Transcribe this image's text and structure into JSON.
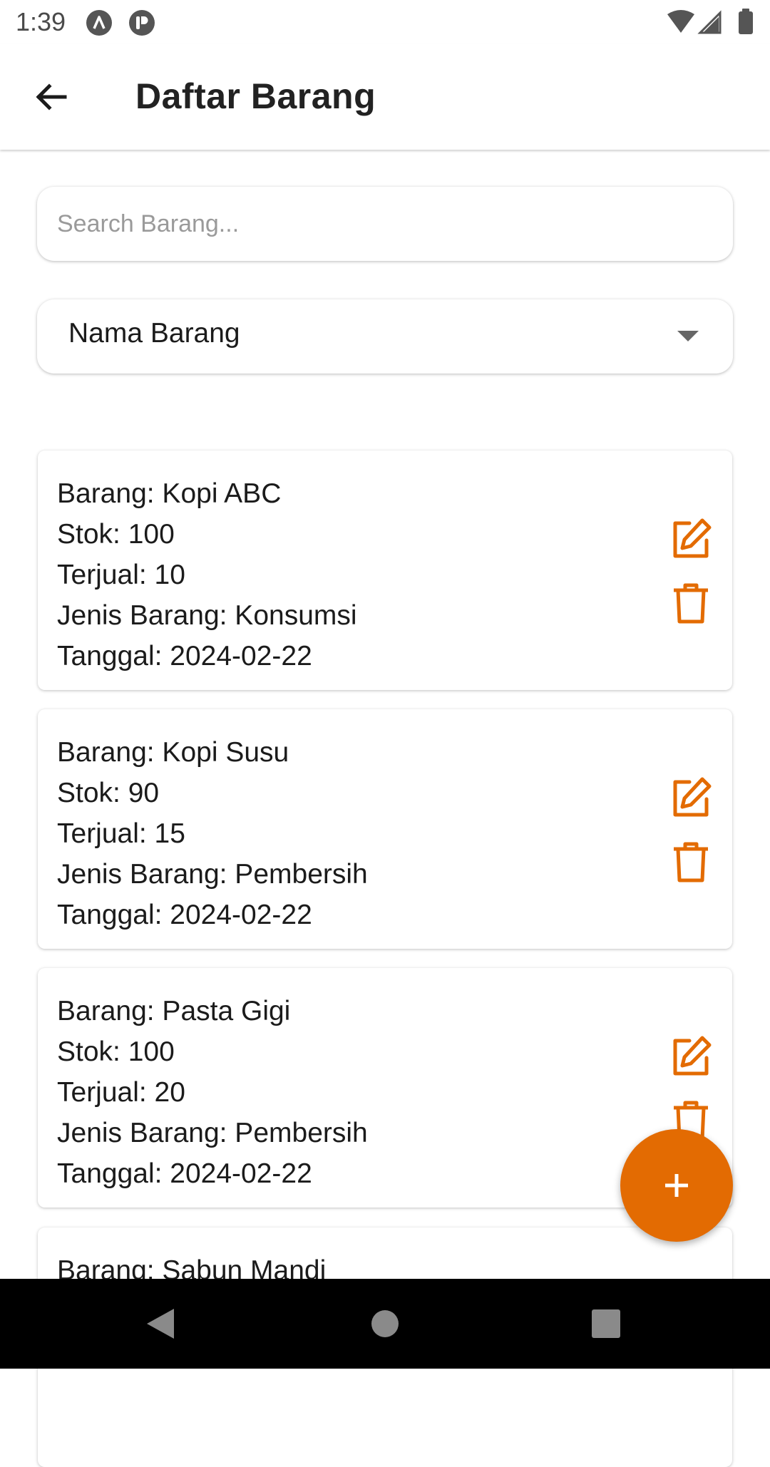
{
  "status_bar": {
    "time": "1:39",
    "icons": [
      "a-notification-icon",
      "p-notification-icon",
      "wifi-icon",
      "signal-icon",
      "battery-icon"
    ]
  },
  "app_bar": {
    "title": "Daftar Barang",
    "back_icon": "arrow-left-icon"
  },
  "search": {
    "placeholder": "Search Barang...",
    "value": ""
  },
  "sort_select": {
    "selected": "Nama Barang"
  },
  "items": [
    {
      "barang": "Barang: Kopi ABC",
      "stok": "Stok: 100",
      "terjual": "Terjual: 10",
      "jenis": "Jenis Barang: Konsumsi",
      "tanggal": "Tanggal: 2024-02-22"
    },
    {
      "barang": "Barang: Kopi Susu",
      "stok": "Stok: 90",
      "terjual": "Terjual: 15",
      "jenis": "Jenis Barang: Pembersih",
      "tanggal": "Tanggal: 2024-02-22"
    },
    {
      "barang": "Barang: Pasta Gigi",
      "stok": "Stok: 100",
      "terjual": "Terjual: 20",
      "jenis": "Jenis Barang: Pembersih",
      "tanggal": "Tanggal: 2024-02-22"
    },
    {
      "barang": "Barang: Sabun Mandi"
    }
  ],
  "fab": {
    "icon": "plus-icon"
  },
  "colors": {
    "accent": "#e36b02",
    "text": "#1b1b1b",
    "placeholder": "#9a9a9a"
  }
}
